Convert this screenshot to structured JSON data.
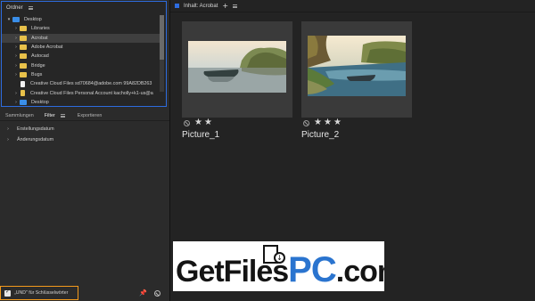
{
  "folders_panel": {
    "title": "Ordner",
    "items": [
      {
        "label": "Desktop",
        "chevron": "▾",
        "icon": "blue",
        "indent": 4
      },
      {
        "label": "Libraries",
        "chevron": "›",
        "icon": "yellow",
        "indent": 12
      },
      {
        "label": "Acrobat",
        "chevron": "›",
        "icon": "yellow",
        "indent": 12,
        "selected": true
      },
      {
        "label": "Adobe Acrobat",
        "chevron": "›",
        "icon": "yellow",
        "indent": 12
      },
      {
        "label": "Autocad",
        "chevron": "›",
        "icon": "yellow",
        "indent": 12
      },
      {
        "label": "Bridge",
        "chevron": "›",
        "icon": "yellow",
        "indent": 12
      },
      {
        "label": "Bugs",
        "chevron": "›",
        "icon": "yellow",
        "indent": 12
      },
      {
        "label": "Creative Cloud Files  sd70684@adobe.com  99A82DB263",
        "chevron": "",
        "icon": "doc",
        "indent": 12
      },
      {
        "label": "Creative Cloud Files Personal Account kacholly+k1-us@a",
        "chevron": "›",
        "icon": "ycard",
        "indent": 12
      },
      {
        "label": "Desktop",
        "chevron": "›",
        "icon": "blue",
        "indent": 12
      }
    ]
  },
  "tabs": [
    {
      "label": "Sammlungen",
      "active": false
    },
    {
      "label": "Filter",
      "active": true
    },
    {
      "label": "Exportieren",
      "active": false
    }
  ],
  "filters": [
    {
      "label": "Erstellungsdatum"
    },
    {
      "label": "Änderungsdatum"
    }
  ],
  "footer": {
    "and_keywords_label": "„UND\" für Schlüsselwörter",
    "checked": true
  },
  "content": {
    "title": "Inhalt: Acrobat",
    "pictures": [
      {
        "name": "Picture_1",
        "rating": 2,
        "max_rating": 5
      },
      {
        "name": "Picture_2",
        "rating": 3,
        "max_rating": 5
      }
    ]
  },
  "watermark": {
    "text_prefix": "GetFiles",
    "text_pc": "PC",
    "text_suffix": ".com"
  }
}
